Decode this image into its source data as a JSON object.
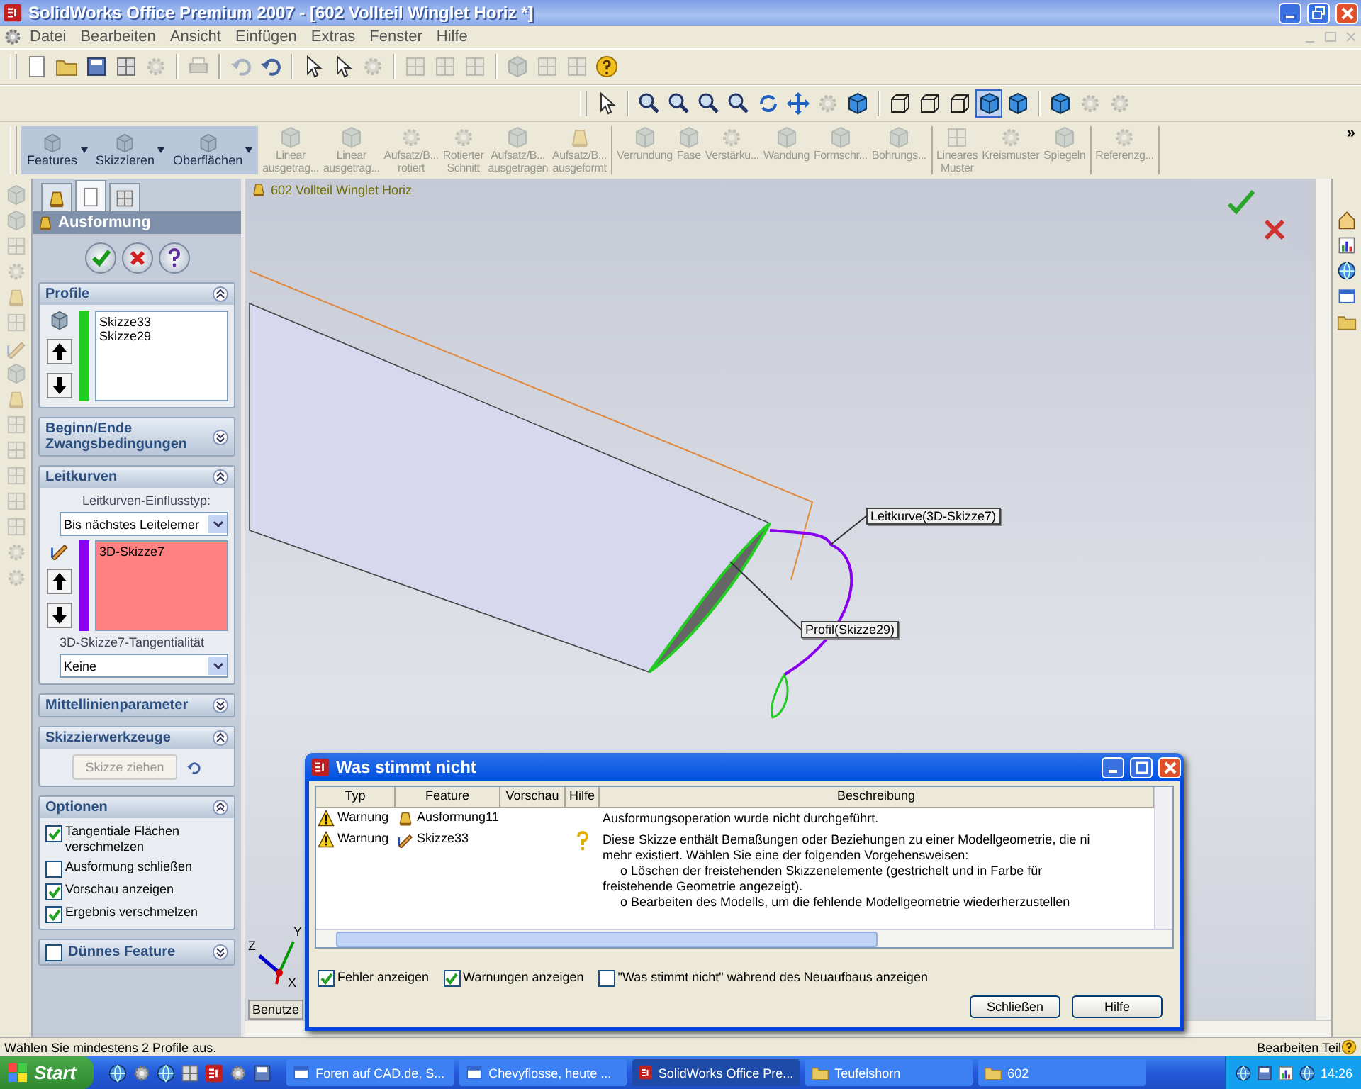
{
  "window": {
    "title": "SolidWorks Office Premium 2007 - [602 Vollteil Winglet Horiz *]"
  },
  "menu": [
    "Datei",
    "Bearbeiten",
    "Ansicht",
    "Einfügen",
    "Extras",
    "Fenster",
    "Hilfe"
  ],
  "command_manager": {
    "flyouts": [
      "Features",
      "Skizzieren",
      "Oberflächen"
    ],
    "tool_groups": [
      [
        {
          "label": "Linear\nausgetrag...",
          "disabled": true
        },
        {
          "label": "Linear\nausgetrag...",
          "disabled": true
        },
        {
          "label": "Aufsatz/B...\nrotiert",
          "disabled": true
        },
        {
          "label": "Rotierter\nSchnitt",
          "disabled": true
        },
        {
          "label": "Aufsatz/B...\nausgetragen",
          "disabled": true
        },
        {
          "label": "Aufsatz/B...\nausgeformt",
          "disabled": true
        }
      ],
      [
        {
          "label": "Verrundung",
          "disabled": true
        },
        {
          "label": "Fase",
          "disabled": true
        },
        {
          "label": "Verstärku...",
          "disabled": true
        },
        {
          "label": "Wandung",
          "disabled": true
        },
        {
          "label": "Formschr...",
          "disabled": true
        },
        {
          "label": "Bohrungs...",
          "disabled": true
        }
      ],
      [
        {
          "label": "Lineares\nMuster",
          "disabled": true
        },
        {
          "label": "Kreismuster",
          "disabled": true
        },
        {
          "label": "Spiegeln",
          "disabled": true
        }
      ],
      [
        {
          "label": "Referenzg...",
          "disabled": true
        }
      ]
    ],
    "more": "»"
  },
  "property_manager": {
    "tabs": [
      {
        "kind": "tree",
        "selected": false
      },
      {
        "kind": "property",
        "selected": true
      },
      {
        "kind": "config",
        "selected": false
      }
    ],
    "title": "Ausformung",
    "sections": [
      {
        "kind": "profiles",
        "title": "Profile",
        "expanded": true,
        "items": [
          "Skizze33",
          "Skizze29"
        ],
        "color": "#22cc22",
        "active": false
      },
      {
        "kind": "plain",
        "title": "Beginn/Ende Zwangsbedingungen",
        "expanded": false
      },
      {
        "kind": "guides",
        "title": "Leitkurven",
        "expanded": true,
        "influence_label": "Leitkurven-Einflusstyp:",
        "influence_value": "Bis nächstes Leitelemer",
        "items": [
          "3D-Skizze7"
        ],
        "color": "#8800ee",
        "active": true,
        "tangency_label": "3D-Skizze7-Tangentialität",
        "tangency_value": "Keine"
      },
      {
        "kind": "plain",
        "title": "Mittellinienparameter",
        "expanded": false
      },
      {
        "kind": "tools",
        "title": "Skizzierwerkzeuge",
        "expanded": true,
        "button": "Skizze ziehen",
        "button_disabled": true
      },
      {
        "kind": "options",
        "title": "Optionen",
        "expanded": true,
        "options": [
          {
            "label": "Tangentiale Flächen verschmelzen",
            "checked": true
          },
          {
            "label": "Ausformung schließen",
            "checked": false
          },
          {
            "label": "Vorschau anzeigen",
            "checked": true
          },
          {
            "label": "Ergebnis verschmelzen",
            "checked": true
          }
        ]
      },
      {
        "kind": "thin",
        "title": "Dünnes Feature",
        "expanded": false,
        "checked": false
      }
    ]
  },
  "viewport": {
    "tree_label": "602 Vollteil Winglet Horiz",
    "callouts": [
      "Leitkurve(3D-Skizze7)",
      "Profil(Skizze29)"
    ],
    "axes": [
      "Y",
      "X",
      "Z"
    ],
    "model_tab": "Benutze"
  },
  "dialog": {
    "title": "Was stimmt nicht",
    "columns": [
      "Typ",
      "Feature",
      "Vorschau",
      "Hilfe",
      "Beschreibung"
    ],
    "rows": [
      {
        "type": "Warnung",
        "feature": "Ausformung11",
        "help": false,
        "description": [
          "Ausformungsoperation wurde nicht durchgeführt."
        ]
      },
      {
        "type": "Warnung",
        "feature": "Skizze33",
        "help": true,
        "description": [
          "Diese Skizze enthält Bemaßungen oder Beziehungen zu einer Modellgeometrie, die ni",
          "mehr existiert. Wählen Sie eine der folgenden Vorgehensweisen:",
          "     o Löschen der freistehenden Skizzenelemente (gestrichelt und in Farbe für",
          "freistehende Geometrie angezeigt).",
          "     o Bearbeiten des Modells, um die fehlende Modellgeometrie wiederherzustellen"
        ]
      }
    ],
    "checkboxes": [
      {
        "label": "Fehler anzeigen",
        "checked": true
      },
      {
        "label": "Warnungen anzeigen",
        "checked": true
      },
      {
        "label": "\"Was stimmt nicht\" während des Neuaufbaus anzeigen",
        "checked": false
      }
    ],
    "buttons": [
      "Schließen",
      "Hilfe"
    ]
  },
  "status_bar": {
    "message": "Wählen Sie mindestens 2 Profile aus.",
    "mode": "Bearbeiten Teil"
  },
  "taskbar": {
    "start": "Start",
    "tasks": [
      {
        "label": "Foren auf CAD.de, S...",
        "selected": false
      },
      {
        "label": "Chevyflosse, heute ...",
        "selected": false
      },
      {
        "label": "SolidWorks Office Pre...",
        "selected": true
      },
      {
        "label": "Teufelshorn",
        "selected": false
      },
      {
        "label": "602",
        "selected": false
      }
    ],
    "clock": "14:26"
  }
}
